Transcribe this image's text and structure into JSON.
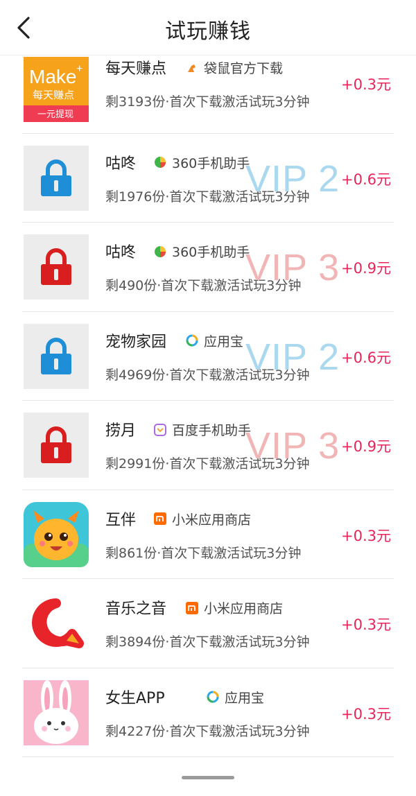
{
  "header": {
    "title": "试玩赚钱"
  },
  "colors": {
    "reward": "#e8245a",
    "vip2": "#a9d8ef",
    "vip3": "#f2b5b5",
    "lock_blue": "#1e8fd6",
    "lock_red": "#d81e1e"
  },
  "items": [
    {
      "name": "每天赚点",
      "source": "袋鼠官方下载",
      "source_icon": "kangaroo-icon",
      "desc": "剩3193份·首次下载激活试玩3分钟",
      "reward": "+0.3元",
      "vip": "",
      "logo_text": {
        "brand": "Make",
        "plus": "+",
        "line1": "每天赚点",
        "line2": "一元提现"
      }
    },
    {
      "name": "咕咚",
      "source": "360手机助手",
      "source_icon": "360-icon",
      "desc": "剩1976份·首次下载激活试玩3分钟",
      "reward": "+0.6元",
      "vip": "VIP 2"
    },
    {
      "name": "咕咚",
      "source": "360手机助手",
      "source_icon": "360-icon",
      "desc": "剩490份·首次下载激活试玩3分钟",
      "reward": "+0.9元",
      "vip": "VIP 3"
    },
    {
      "name": "宠物家园",
      "source": "应用宝",
      "source_icon": "yingyongbao-icon",
      "desc": "剩4969份·首次下载激活试玩3分钟",
      "reward": "+0.6元",
      "vip": "VIP 2"
    },
    {
      "name": "捞月",
      "source": "百度手机助手",
      "source_icon": "baidu-icon",
      "desc": "剩2991份·首次下载激活试玩3分钟",
      "reward": "+0.9元",
      "vip": "VIP 3"
    },
    {
      "name": "互伴",
      "source": "小米应用商店",
      "source_icon": "xiaomi-icon",
      "desc": "剩861份·首次下载激活试玩3分钟",
      "reward": "+0.3元",
      "vip": ""
    },
    {
      "name": "音乐之音",
      "source": "小米应用商店",
      "source_icon": "xiaomi-icon",
      "desc": "剩3894份·首次下载激活试玩3分钟",
      "reward": "+0.3元",
      "vip": ""
    },
    {
      "name": "女生APP",
      "source": "应用宝",
      "source_icon": "yingyongbao-icon",
      "desc": "剩4227份·首次下载激活试玩3分钟",
      "reward": "+0.3元",
      "vip": ""
    }
  ]
}
